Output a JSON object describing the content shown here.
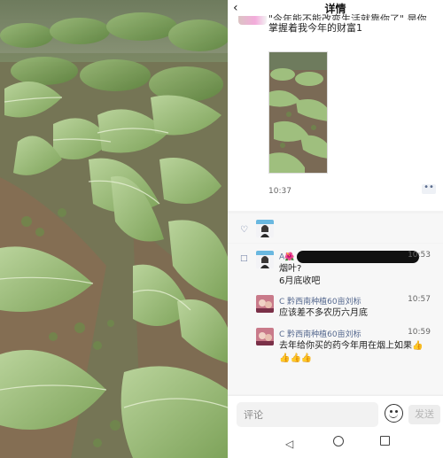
{
  "header": {
    "title": "详情"
  },
  "post": {
    "text_line1": "\"今年能不能改变生活就靠你了\" 是你",
    "text_line2": "掌握着我今年的财富1",
    "time": "10:37",
    "more_glyph": "••"
  },
  "comments": [
    {
      "name": "A🌺",
      "time": "10:53",
      "text_line1": "烟叶?",
      "text_line2": "6月底收吧"
    },
    {
      "name": "C 黔西南种植60亩刘标",
      "time": "10:57",
      "text_line1": "应该差不多农历六月底",
      "text_line2": ""
    },
    {
      "name": "C 黔西南种植60亩刘标",
      "time": "10:59",
      "text_line1": "去年给你买的药今年用在烟上如果👍",
      "text_line2": "👍👍👍"
    }
  ],
  "input": {
    "placeholder": "评论",
    "send_label": "发送"
  },
  "icons": {
    "back": "chevron-left-icon",
    "like": "heart-icon",
    "comment": "comment-icon",
    "emoji": "emoji-icon",
    "nav_back": "triangle-back-icon",
    "nav_home": "circle-home-icon",
    "nav_recent": "square-recent-icon"
  },
  "colors": {
    "link_name": "#56698f",
    "panel_bg": "#f7f7f7",
    "leaf": "#8fb26a"
  }
}
